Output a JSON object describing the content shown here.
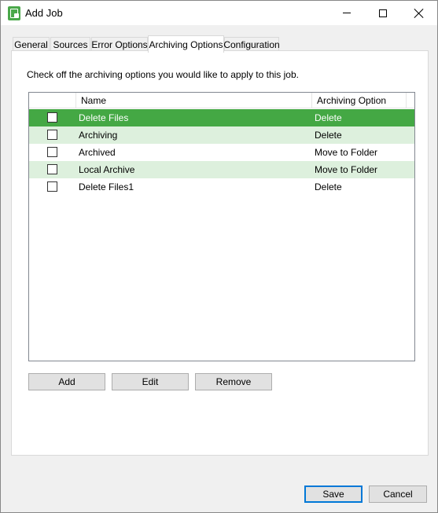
{
  "window": {
    "title": "Add Job",
    "controls": {
      "minimize_icon": "minimize-icon",
      "maximize_icon": "maximize-icon",
      "close_icon": "close-icon"
    }
  },
  "tabs": [
    {
      "label": "General",
      "active": false
    },
    {
      "label": "Sources",
      "active": false
    },
    {
      "label": "Error Options",
      "active": false
    },
    {
      "label": "Archiving Options",
      "active": true
    },
    {
      "label": "Configuration",
      "active": false
    }
  ],
  "archiving": {
    "instruction": "Check off the archiving options you would like to apply to this job.",
    "columns": {
      "check": "",
      "name": "Name",
      "option": "Archiving Option"
    },
    "rows": [
      {
        "name": "Delete Files",
        "option": "Delete",
        "checked": false,
        "selected": true
      },
      {
        "name": "Archiving",
        "option": "Delete",
        "checked": false,
        "selected": false
      },
      {
        "name": "Archived",
        "option": "Move to Folder",
        "checked": false,
        "selected": false
      },
      {
        "name": "Local Archive",
        "option": "Move to Folder",
        "checked": false,
        "selected": false
      },
      {
        "name": "Delete Files1",
        "option": "Delete",
        "checked": false,
        "selected": false
      }
    ],
    "buttons": {
      "add": "Add",
      "edit": "Edit",
      "remove": "Remove"
    }
  },
  "footer": {
    "save": "Save",
    "cancel": "Cancel"
  },
  "colors": {
    "selected_row": "#44a844",
    "alt_row": "#ddf0dd",
    "accent": "#0078d7"
  }
}
